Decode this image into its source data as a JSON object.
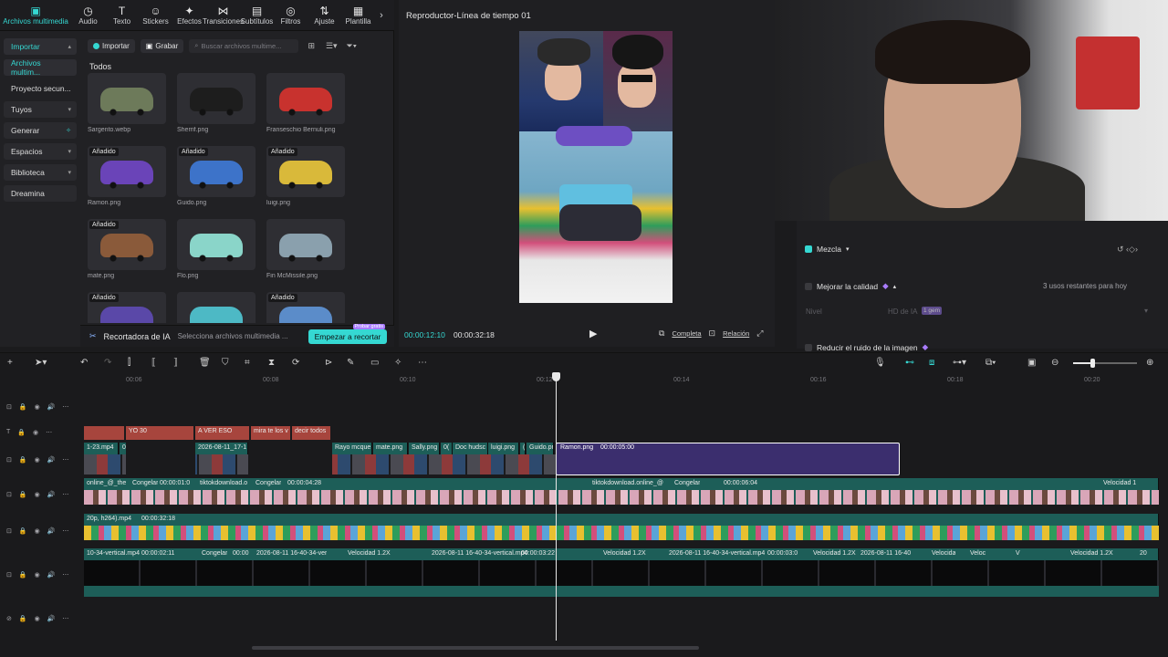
{
  "toolbar": {
    "items": [
      {
        "label": "Archivos multimedia",
        "icon": "media-icon",
        "active": true
      },
      {
        "label": "Audio",
        "icon": "audio-icon"
      },
      {
        "label": "Texto",
        "icon": "text-icon"
      },
      {
        "label": "Stickers",
        "icon": "sticker-icon"
      },
      {
        "label": "Efectos",
        "icon": "effects-icon"
      },
      {
        "label": "Transiciones",
        "icon": "transition-icon"
      },
      {
        "label": "Subtítulos",
        "icon": "subtitles-icon"
      },
      {
        "label": "Filtros",
        "icon": "filter-icon"
      },
      {
        "label": "Ajuste",
        "icon": "adjust-icon"
      },
      {
        "label": "Plantilla",
        "icon": "template-icon"
      }
    ]
  },
  "sidebar": {
    "items": [
      {
        "label": "Importar",
        "chevron": "▴"
      },
      {
        "label": "Archivos multim...",
        "chevron": ""
      },
      {
        "label": "Proyecto secun...",
        "chevron": ""
      },
      {
        "label": "Tuyos",
        "chevron": "▾"
      },
      {
        "label": "Generar",
        "chevron": ""
      },
      {
        "label": "Espacios",
        "chevron": "▾"
      },
      {
        "label": "Biblioteca",
        "chevron": "▾"
      },
      {
        "label": "Dreamina",
        "chevron": ""
      }
    ]
  },
  "media": {
    "import_label": "Importar",
    "record_label": "Grabar",
    "search_placeholder": "Buscar archivos multime...",
    "section_title": "Todos",
    "added_label": "Añadido",
    "items": [
      {
        "name": "Sargento.webp",
        "added": false,
        "color": "#6d7a5a"
      },
      {
        "name": "Sherrif.png",
        "added": false,
        "color": "#1d1d1d"
      },
      {
        "name": "Franseschio Bernuli.png",
        "added": false,
        "color": "#c8322e"
      },
      {
        "name": "Ramon.png",
        "added": true,
        "color": "#6a44b8"
      },
      {
        "name": "Guido.png",
        "added": true,
        "color": "#3d73c9"
      },
      {
        "name": "luigi.png",
        "added": true,
        "color": "#d9b93a"
      },
      {
        "name": "mate.png",
        "added": true,
        "color": "#8a5a3a"
      },
      {
        "name": "Flo.png",
        "added": false,
        "color": "#8ad5c9"
      },
      {
        "name": "Fin McMissile.png",
        "added": false,
        "color": "#8aa0ad"
      },
      {
        "name": "",
        "added": true,
        "color": "#5a48a8"
      },
      {
        "name": "",
        "added": false,
        "color": "#4db9c5"
      },
      {
        "name": "",
        "added": true,
        "color": "#5b8cc9"
      }
    ]
  },
  "ai_bar": {
    "title": "Recortadora de IA",
    "hint": "Selecciona archivos multimedia ...",
    "button": "Empezar a recortar",
    "tag": "Probar gratis"
  },
  "player": {
    "title": "Reproductor-Línea de tiempo 01",
    "current_time": "00:00:12:10",
    "total_time": "00:00:32:18",
    "full_label": "Completa",
    "ratio_label": "Relación"
  },
  "properties": {
    "mezcla": "Mezcla",
    "enhance": "Mejorar la calidad",
    "remaining": "3 usos restantes para hoy",
    "level_label": "Nivel",
    "level_value": "HD de IA",
    "level_tag": "1 gem",
    "noise": "Reducir el ruido de la imagen"
  },
  "timeline": {
    "ticks": [
      "00:06",
      "00:08",
      "00:10",
      "00:12",
      "00:14",
      "00:16",
      "00:18",
      "00:20"
    ],
    "text_clips": [
      "",
      "YO 30",
      "A VER ESO",
      "mira te los v",
      "decir todos"
    ],
    "video_row1": [
      "1-23.mp4",
      "0(",
      "2026-08-11_17-1",
      "Rayo mcque",
      "mate.png",
      "Sally.png",
      "0(",
      "Doc hudsc",
      "luigi.png",
      "(",
      "Guido.pr"
    ],
    "selected_clip": {
      "name": "Ramon.png",
      "duration": "00:00:05:00"
    },
    "video_row2": [
      "online_@_the",
      "Congelar",
      "00:00:01:0",
      "tiktokdownload.o",
      "Congelar",
      "00:00:04:28",
      "tiktokdownload.online_@",
      "Congelar",
      "00:00:06:04",
      "Velocidad 1"
    ],
    "video_row3": [
      "20p, h264).mp4",
      "00:00:32:18"
    ],
    "video_row4": [
      "10-34-vertical.mp4",
      "00:00:02:11",
      "Congelar",
      "00:00",
      "2026-08-11 16-40-34-ver",
      "Velocidad 1.2X",
      "2026-08-11 16-40-34-vertical.mp4",
      "00:00:03:22",
      "Velocidad 1.2X",
      "2026-08-11 16-40-34-vertical.mp4",
      "00:00:03:0",
      "Velocidad 1.2X",
      "2026-08-11 16-40",
      "Velocida",
      "Veloc",
      "V",
      "Velocidad 1.2X",
      "20"
    ]
  }
}
